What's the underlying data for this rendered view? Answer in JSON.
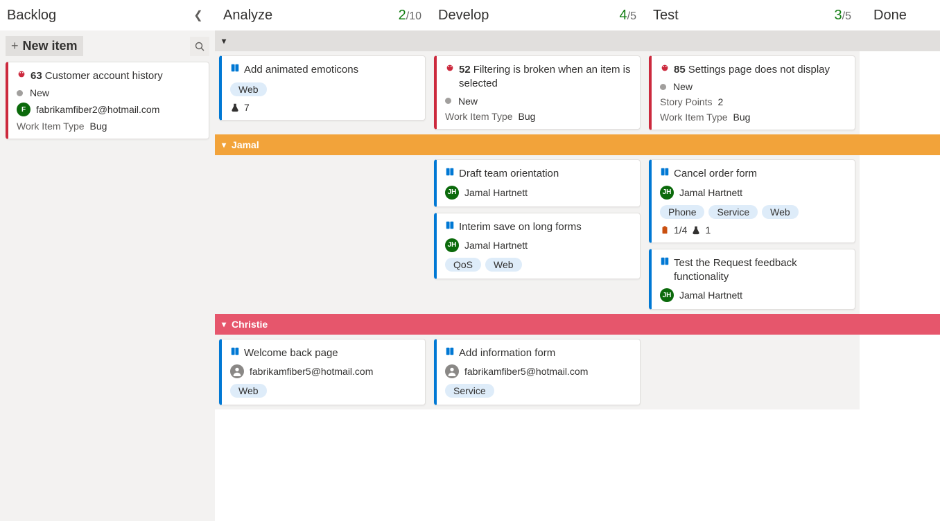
{
  "columns": {
    "backlog": {
      "title": "Backlog"
    },
    "analyze": {
      "title": "Analyze",
      "current": "2",
      "max": "10"
    },
    "develop": {
      "title": "Develop",
      "current": "4",
      "max": "5"
    },
    "test": {
      "title": "Test",
      "current": "3",
      "max": "5"
    },
    "done": {
      "title": "Done"
    }
  },
  "newitem_label": "New item",
  "swimlanes": {
    "jamal": {
      "name": "Jamal"
    },
    "christie": {
      "name": "Christie"
    }
  },
  "cards": {
    "backlog0": {
      "id": "63",
      "title": "Customer account history",
      "state": "New",
      "assignee": "fabrikamfiber2@hotmail.com",
      "avatar_letter": "F",
      "wit_label": "Work Item Type",
      "wit_value": "Bug"
    },
    "analyze0": {
      "title": "Add animated emoticons",
      "tags": [
        "Web"
      ],
      "flask": "7"
    },
    "develop0": {
      "id": "52",
      "title": "Filtering is broken when an item is selected",
      "state": "New",
      "wit_label": "Work Item Type",
      "wit_value": "Bug"
    },
    "test0": {
      "id": "85",
      "title": "Settings page does not display",
      "state": "New",
      "sp_label": "Story Points",
      "sp_value": "2",
      "wit_label": "Work Item Type",
      "wit_value": "Bug"
    },
    "j_dev0": {
      "title": "Draft team orientation",
      "assignee": "Jamal Hartnett",
      "avatar_letter": "JH"
    },
    "j_dev1": {
      "title": "Interim save on long forms",
      "assignee": "Jamal Hartnett",
      "avatar_letter": "JH",
      "tags": [
        "QoS",
        "Web"
      ]
    },
    "j_test0": {
      "title": "Cancel order form",
      "assignee": "Jamal Hartnett",
      "avatar_letter": "JH",
      "tags": [
        "Phone",
        "Service",
        "Web"
      ],
      "checklist": "1/4",
      "flask": "1"
    },
    "j_test1": {
      "title": "Test the Request feedback functionality",
      "assignee": "Jamal Hartnett",
      "avatar_letter": "JH"
    },
    "c_an0": {
      "title": "Welcome back page",
      "assignee": "fabrikamfiber5@hotmail.com",
      "tags": [
        "Web"
      ]
    },
    "c_dev0": {
      "title": "Add information form",
      "assignee": "fabrikamfiber5@hotmail.com",
      "tags": [
        "Service"
      ]
    }
  }
}
